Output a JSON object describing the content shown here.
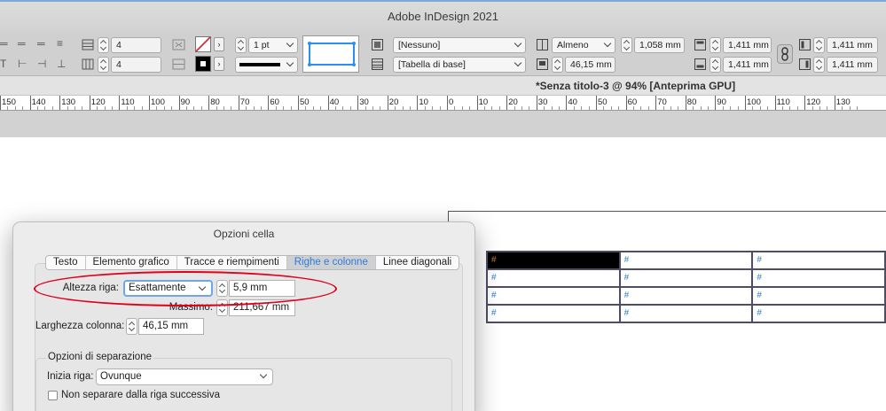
{
  "app": {
    "title": "Adobe InDesign 2021"
  },
  "control_bar": {
    "rows_value": "4",
    "columns_value": "4",
    "stroke_weight": "1 pt",
    "cell_style": "[Nessuno]",
    "table_style": "[Tabella di base]",
    "row_height_mode": "Almeno",
    "row_height_value": "1,058 mm",
    "column_width_value": "46,15 mm",
    "inset_top": "1,411 mm",
    "inset_bottom": "1,411 mm",
    "inset_left": "1,411 mm",
    "inset_right": "1,411 mm",
    "stroke_color": "#e02020",
    "fill_color": "#000000",
    "proxy_color": "#2a8ff0"
  },
  "document": {
    "tab_title": "*Senza titolo-3 @ 94% [Anteprima GPU]",
    "ruler_labels": [
      "150",
      "140",
      "130",
      "120",
      "110",
      "100",
      "90",
      "80",
      "70",
      "60",
      "50",
      "40",
      "30",
      "20",
      "10",
      "0",
      "10",
      "20",
      "30",
      "40",
      "50",
      "60",
      "70",
      "80",
      "90",
      "100",
      "110",
      "120",
      "130"
    ],
    "table_cells": [
      [
        "#",
        "#",
        "#"
      ],
      [
        "#",
        "#",
        "#"
      ],
      [
        "#",
        "#",
        "#"
      ],
      [
        "#",
        "#",
        "#"
      ]
    ]
  },
  "dialog": {
    "title": "Opzioni cella",
    "tabs": [
      "Testo",
      "Elemento grafico",
      "Tracce e riempimenti",
      "Righe e colonne",
      "Linee diagonali"
    ],
    "active_tab": "Righe e colonne",
    "row_height_label": "Altezza riga:",
    "row_height_mode": "Esattamente",
    "row_height_value": "5,9 mm",
    "max_label": "Massimo:",
    "max_value": "211,667 mm",
    "column_width_label": "Larghezza colonna:",
    "column_width_value": "46,15 mm",
    "keep_options_title": "Opzioni di separazione",
    "start_row_label": "Inizia riga:",
    "start_row_value": "Ovunque",
    "keep_with_next_label": "Non separare dalla riga successiva",
    "highlight_color": "#e0001b"
  }
}
